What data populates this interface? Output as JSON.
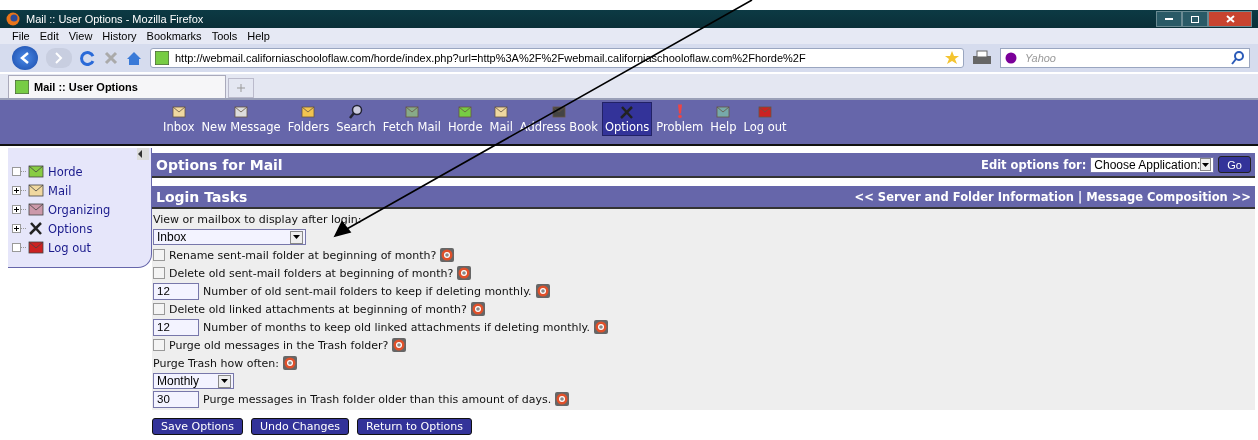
{
  "window": {
    "title": "Mail :: User Options - Mozilla Firefox"
  },
  "menu": [
    "File",
    "Edit",
    "View",
    "History",
    "Bookmarks",
    "Tools",
    "Help"
  ],
  "address": {
    "value": "http://webmail.californiaschooloflaw.com/horde/index.php?url=http%3A%2F%2Fwebmail.californiaschooloflaw.com%2Fhorde%2F"
  },
  "search": {
    "placeholder": "Yahoo"
  },
  "tabs": [
    {
      "label": "Mail :: User Options",
      "selected": true
    }
  ],
  "toolbar": [
    {
      "label": "Inbox",
      "selected": false
    },
    {
      "label": "New Message",
      "selected": false
    },
    {
      "label": "Folders",
      "selected": false
    },
    {
      "label": "Search",
      "selected": false
    },
    {
      "label": "Fetch Mail",
      "selected": false
    },
    {
      "label": "Horde",
      "selected": false
    },
    {
      "label": "Mail",
      "selected": false
    },
    {
      "label": "Address Book",
      "selected": false
    },
    {
      "label": "Options",
      "selected": true
    },
    {
      "label": "Problem",
      "selected": false
    },
    {
      "label": "Help",
      "selected": false
    },
    {
      "label": "Log out",
      "selected": false
    }
  ],
  "sidebar": {
    "items": [
      {
        "label": "Horde",
        "expandable": false
      },
      {
        "label": "Mail",
        "expandable": true
      },
      {
        "label": "Organizing",
        "expandable": true
      },
      {
        "label": "Options",
        "expandable": true
      },
      {
        "label": "Log out",
        "expandable": false
      }
    ]
  },
  "header": {
    "title": "Options for Mail",
    "edit_label": "Edit options for:",
    "app_select": "Choose Application:",
    "go": "Go"
  },
  "section": {
    "title": "Login Tasks",
    "prev": "<< Server and Folder Information",
    "separator": "|",
    "next": "Message Composition >>"
  },
  "rows": [
    {
      "kind": "caption",
      "text": "View or mailbox to display after login:",
      "help": false
    },
    {
      "kind": "select",
      "value": "Inbox"
    },
    {
      "kind": "checkbox",
      "text": "Rename sent-mail folder at beginning of month?",
      "checked": false,
      "help": true
    },
    {
      "kind": "checkbox",
      "text": "Delete old sent-mail folders at beginning of month?",
      "checked": false,
      "help": true
    },
    {
      "kind": "number",
      "value": "12",
      "text": "Number of old sent-mail folders to keep if deleting monthly.",
      "help": true
    },
    {
      "kind": "checkbox",
      "text": "Delete old linked attachments at beginning of month?",
      "checked": false,
      "help": true
    },
    {
      "kind": "number",
      "value": "12",
      "text": "Number of months to keep old linked attachments if deleting monthly.",
      "help": true
    },
    {
      "kind": "checkbox",
      "text": "Purge old messages in the Trash folder?",
      "checked": false,
      "help": true
    },
    {
      "kind": "caption",
      "text": "Purge Trash how often:",
      "help": true
    },
    {
      "kind": "small-select",
      "value": "Monthly"
    },
    {
      "kind": "number",
      "value": "30",
      "text": "Purge messages in Trash folder older than this amount of days.",
      "help": true
    }
  ],
  "buttons": [
    "Save Options",
    "Undo Changes",
    "Return to Options"
  ]
}
